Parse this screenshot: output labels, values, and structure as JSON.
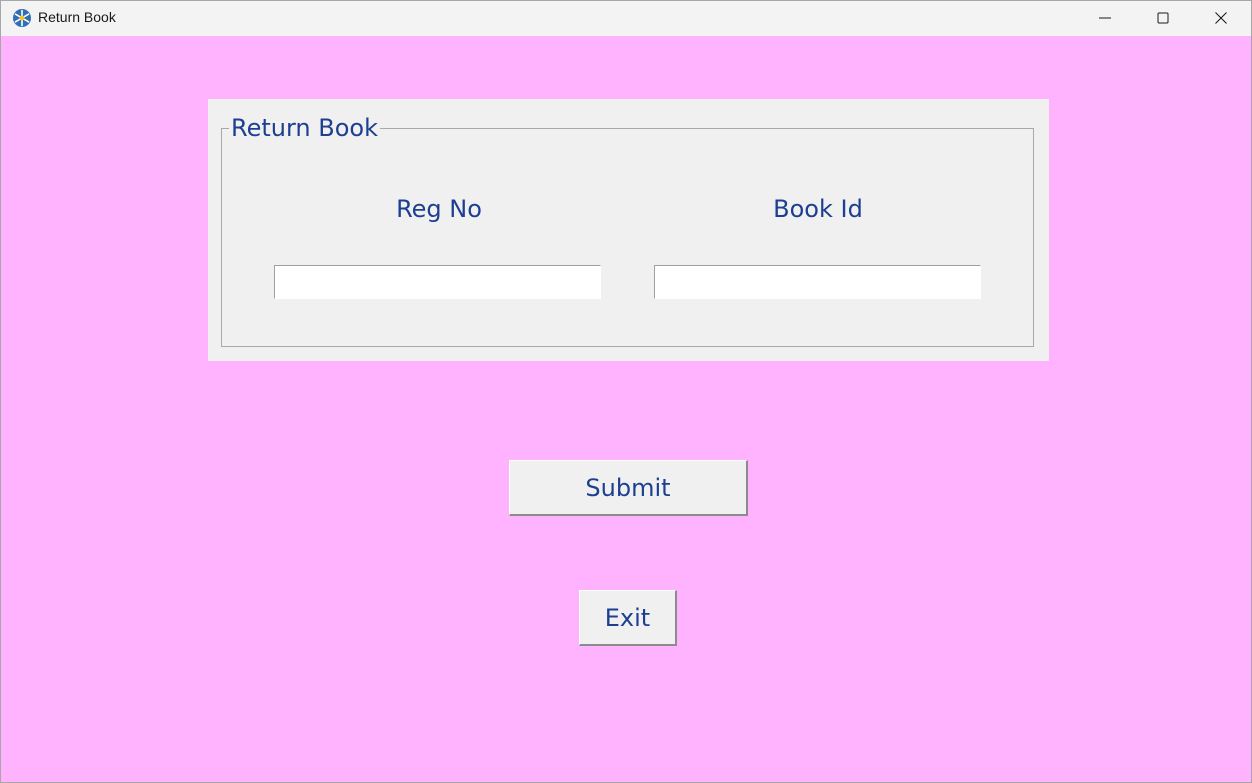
{
  "window": {
    "title": "Return Book",
    "icon": "tkinter-feather-icon",
    "controls": [
      "minimize-icon",
      "maximize-icon",
      "close-icon"
    ]
  },
  "form": {
    "group_title": "Return Book",
    "fields": [
      {
        "label": "Reg No",
        "value": ""
      },
      {
        "label": "Book Id",
        "value": ""
      }
    ]
  },
  "buttons": {
    "submit": "Submit",
    "exit": "Exit"
  },
  "colors": {
    "background": "#ffb3ff",
    "panel": "#f0f0f0",
    "text": "#1d3f91"
  }
}
